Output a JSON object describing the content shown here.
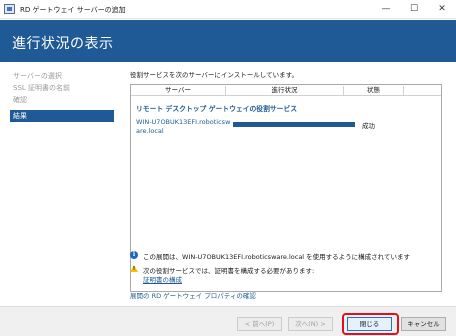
{
  "window": {
    "title": "RD ゲートウェイ サーバーの追加",
    "controls": [
      "minimize",
      "maximize",
      "close"
    ]
  },
  "header": {
    "title": "進行状況の表示"
  },
  "sidebar": {
    "items": [
      {
        "label": "サーバーの選択",
        "state": "disabled"
      },
      {
        "label": "SSL 証明書の名前",
        "state": "disabled"
      },
      {
        "label": "確認",
        "state": "disabled"
      },
      {
        "label": "結果",
        "state": "active"
      }
    ]
  },
  "main": {
    "description": "役割サービスを次のサーバーにインストールしています。",
    "table": {
      "columns": [
        "サーバー",
        "進行状況",
        "状態"
      ],
      "group_title": "リモート デスクトップ ゲートウェイの役割サービス",
      "rows": [
        {
          "server": "WIN-U7OBUK13EFI.roboticsware.local",
          "progress": 1.0,
          "status": "成功"
        }
      ]
    },
    "info_message": "この展開は、WIN-U7OBUK13EFI.roboticsware.local を使用するように構成されています",
    "warning_message": "次の役割サービスでは、証明書を構成する必要があります:",
    "warning_link": "証明書の構成",
    "bottom_link": "展開の RD ゲートウェイ プロパティの確認"
  },
  "footer": {
    "prev_label": "< 前へ(P)",
    "next_label": "次へ(N) >",
    "close_label": "閉じる",
    "cancel_label": "キャンセル"
  },
  "colors": {
    "accent": "#1f5a96",
    "highlight": "#e0111a",
    "warning": "#f2c200"
  },
  "icons": [
    "app-icon",
    "minimize-icon",
    "maximize-icon",
    "close-icon",
    "info-icon",
    "warning-icon"
  ]
}
